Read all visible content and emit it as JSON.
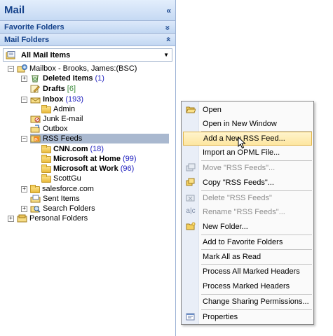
{
  "nav": {
    "title": "Mail",
    "collapse_glyph": "«",
    "favorites_label": "Favorite Folders",
    "favorites_glyph": "»",
    "mail_folders_label": "Mail Folders",
    "mail_folders_glyph": "»",
    "view_selector": "All Mail Items"
  },
  "tree": {
    "mailbox": "Mailbox - Brooks, James:(BSC)",
    "deleted": {
      "label": "Deleted Items",
      "count": "(1)"
    },
    "drafts": {
      "label": "Drafts",
      "count": "[6]"
    },
    "inbox": {
      "label": "Inbox",
      "count": "(193)"
    },
    "admin": "Admin",
    "junk": "Junk E-mail",
    "outbox": "Outbox",
    "rss": "RSS Feeds",
    "cnn": {
      "label": "CNN.com",
      "count": "(18)"
    },
    "ms_home": {
      "label": "Microsoft at Home",
      "count": "(99)"
    },
    "ms_work": {
      "label": "Microsoft at Work",
      "count": "(96)"
    },
    "scottgu": "ScottGu",
    "salesforce": "salesforce.com",
    "sent": "Sent Items",
    "search": "Search Folders",
    "personal": "Personal Folders"
  },
  "menu": {
    "open": "Open",
    "open_new_window": "Open in New Window",
    "add_rss": "Add a New RSS Feed...",
    "import_opml": "Import an OPML File...",
    "move": "Move \"RSS Feeds\"...",
    "copy": "Copy \"RSS Feeds\"...",
    "delete": "Delete \"RSS Feeds\"",
    "rename": "Rename \"RSS Feeds\"...",
    "new_folder": "New Folder...",
    "add_favorite": "Add to Favorite Folders",
    "mark_all_read": "Mark All as Read",
    "process_all": "Process All Marked Headers",
    "process_marked": "Process Marked Headers",
    "change_sharing": "Change Sharing Permissions...",
    "properties": "Properties"
  },
  "colors": {
    "header_text": "#15428b",
    "count_blue": "#1f1fbf",
    "selection": "#a9b8cf",
    "menu_hover": "#fde6a0"
  }
}
